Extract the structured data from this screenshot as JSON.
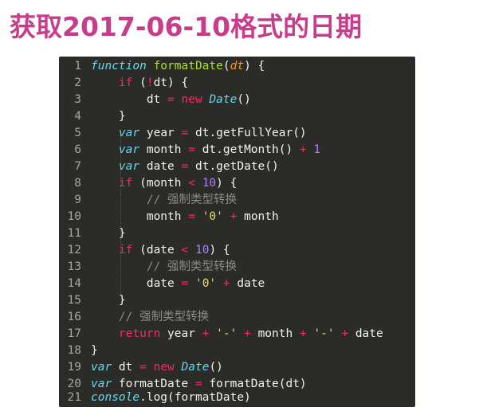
{
  "title": "获取2017-06-10格式的日期",
  "code": {
    "l1": {
      "n": "1",
      "t": [
        [
          "function",
          "kw-fn"
        ],
        [
          " ",
          "plain"
        ],
        [
          "formatDate",
          "func"
        ],
        [
          "(",
          "plain"
        ],
        [
          "dt",
          "param"
        ],
        [
          ") {",
          "plain"
        ]
      ]
    },
    "l2": {
      "n": "2",
      "t": [
        [
          "    ",
          "plain"
        ],
        [
          "if",
          "kw"
        ],
        [
          " (",
          "plain"
        ],
        [
          "!",
          "op"
        ],
        [
          "dt) {",
          "plain"
        ]
      ]
    },
    "l3": {
      "n": "3",
      "t": [
        [
          "        dt ",
          "plain"
        ],
        [
          "=",
          "op"
        ],
        [
          " ",
          "plain"
        ],
        [
          "new",
          "kw"
        ],
        [
          " ",
          "plain"
        ],
        [
          "Date",
          "var"
        ],
        [
          "()",
          "plain"
        ]
      ]
    },
    "l4": {
      "n": "4",
      "t": [
        [
          "    }",
          "plain"
        ]
      ]
    },
    "l5": {
      "n": "5",
      "t": [
        [
          "    ",
          "plain"
        ],
        [
          "var",
          "var"
        ],
        [
          " year ",
          "plain"
        ],
        [
          "=",
          "op"
        ],
        [
          " dt.getFullYear()",
          "plain"
        ]
      ]
    },
    "l6": {
      "n": "6",
      "t": [
        [
          "    ",
          "plain"
        ],
        [
          "var",
          "var"
        ],
        [
          " month ",
          "plain"
        ],
        [
          "=",
          "op"
        ],
        [
          " dt.getMonth() ",
          "plain"
        ],
        [
          "+",
          "op"
        ],
        [
          " ",
          "plain"
        ],
        [
          "1",
          "num"
        ]
      ]
    },
    "l7": {
      "n": "7",
      "t": [
        [
          "    ",
          "plain"
        ],
        [
          "var",
          "var"
        ],
        [
          " date ",
          "plain"
        ],
        [
          "=",
          "op"
        ],
        [
          " dt.getDate()",
          "plain"
        ]
      ]
    },
    "l8": {
      "n": "8",
      "t": [
        [
          "    ",
          "plain"
        ],
        [
          "if",
          "kw"
        ],
        [
          " (month ",
          "plain"
        ],
        [
          "<",
          "op"
        ],
        [
          " ",
          "plain"
        ],
        [
          "10",
          "num"
        ],
        [
          ") {",
          "plain"
        ]
      ]
    },
    "l9": {
      "n": "9",
      "t": [
        [
          "        ",
          "plain"
        ],
        [
          "// 强制类型转换",
          "cmt"
        ]
      ]
    },
    "l10": {
      "n": "10",
      "t": [
        [
          "        month ",
          "plain"
        ],
        [
          "=",
          "op"
        ],
        [
          " ",
          "plain"
        ],
        [
          "'0'",
          "str"
        ],
        [
          " ",
          "plain"
        ],
        [
          "+",
          "op"
        ],
        [
          " month",
          "plain"
        ]
      ]
    },
    "l11": {
      "n": "11",
      "t": [
        [
          "    }",
          "plain"
        ]
      ]
    },
    "l12": {
      "n": "12",
      "t": [
        [
          "    ",
          "plain"
        ],
        [
          "if",
          "kw"
        ],
        [
          " (date ",
          "plain"
        ],
        [
          "<",
          "op"
        ],
        [
          " ",
          "plain"
        ],
        [
          "10",
          "num"
        ],
        [
          ") {",
          "plain"
        ]
      ]
    },
    "l13": {
      "n": "13",
      "t": [
        [
          "        ",
          "plain"
        ],
        [
          "// 强制类型转换",
          "cmt"
        ]
      ]
    },
    "l14": {
      "n": "14",
      "t": [
        [
          "        date ",
          "plain"
        ],
        [
          "=",
          "op"
        ],
        [
          " ",
          "plain"
        ],
        [
          "'0'",
          "str"
        ],
        [
          " ",
          "plain"
        ],
        [
          "+",
          "op"
        ],
        [
          " date",
          "plain"
        ]
      ]
    },
    "l15": {
      "n": "15",
      "t": [
        [
          "    }",
          "plain"
        ]
      ]
    },
    "l16": {
      "n": "16",
      "t": [
        [
          "    ",
          "plain"
        ],
        [
          "// 强制类型转换",
          "cmt"
        ]
      ]
    },
    "l17": {
      "n": "17",
      "t": [
        [
          "    ",
          "plain"
        ],
        [
          "return",
          "kw"
        ],
        [
          " year ",
          "plain"
        ],
        [
          "+",
          "op"
        ],
        [
          " ",
          "plain"
        ],
        [
          "'-'",
          "str"
        ],
        [
          " ",
          "plain"
        ],
        [
          "+",
          "op"
        ],
        [
          " month ",
          "plain"
        ],
        [
          "+",
          "op"
        ],
        [
          " ",
          "plain"
        ],
        [
          "'-'",
          "str"
        ],
        [
          " ",
          "plain"
        ],
        [
          "+",
          "op"
        ],
        [
          " date",
          "plain"
        ]
      ]
    },
    "l18": {
      "n": "18",
      "t": [
        [
          "}",
          "plain"
        ]
      ]
    },
    "l19": {
      "n": "19",
      "t": [
        [
          "var",
          "var"
        ],
        [
          " dt ",
          "plain"
        ],
        [
          "=",
          "op"
        ],
        [
          " ",
          "plain"
        ],
        [
          "new",
          "kw"
        ],
        [
          " ",
          "plain"
        ],
        [
          "Date",
          "var"
        ],
        [
          "()",
          "plain"
        ]
      ]
    },
    "l20": {
      "n": "20",
      "t": [
        [
          "var",
          "var"
        ],
        [
          " formatDate ",
          "plain"
        ],
        [
          "=",
          "op"
        ],
        [
          " formatDate(dt)",
          "plain"
        ]
      ]
    },
    "l21": {
      "n": "21",
      "t": [
        [
          "console",
          "var"
        ],
        [
          ".log(formatDate)",
          "plain"
        ]
      ]
    }
  },
  "colors": {
    "title": "#c93c8b",
    "editor_bg": "#2b2b27",
    "keyword": "#f92672",
    "storage": "#67d8ef",
    "function_name": "#a6e22e",
    "number": "#ae81ff",
    "string": "#e6db74",
    "comment": "#8c8c84"
  }
}
